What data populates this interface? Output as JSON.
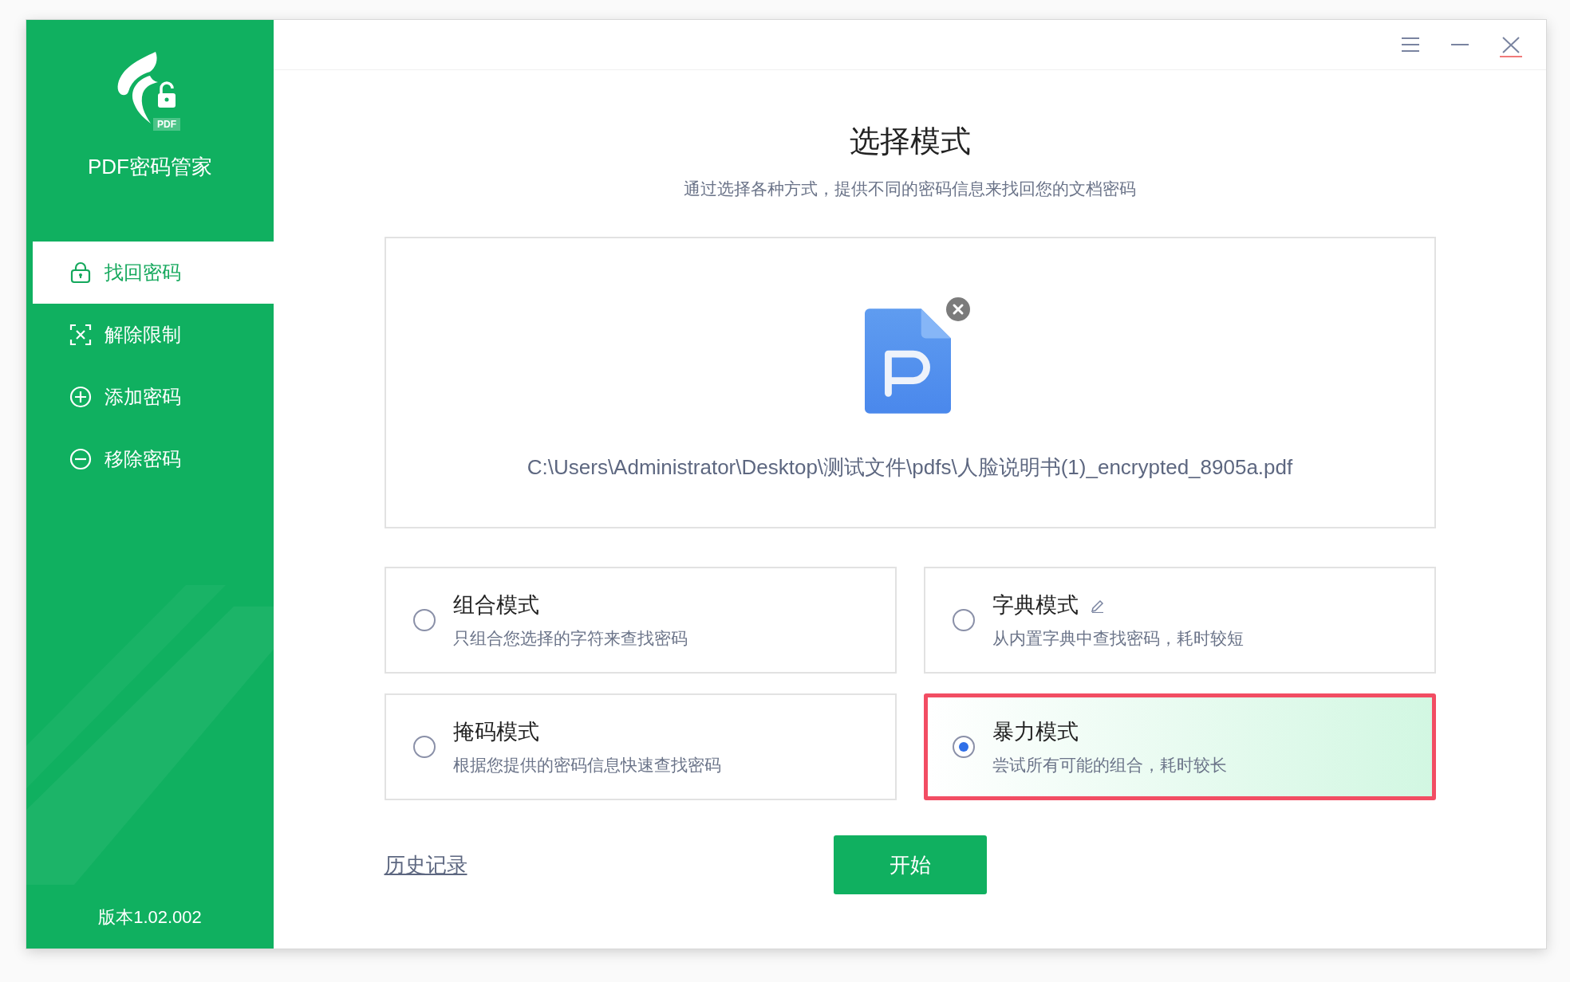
{
  "app": {
    "name": "PDF密码管家",
    "logo_badge": "PDF",
    "version": "版本1.02.002"
  },
  "sidebar": {
    "items": [
      {
        "label": "找回密码",
        "kind": "lock",
        "selected": true
      },
      {
        "label": "解除限制",
        "kind": "frame-x",
        "selected": false
      },
      {
        "label": "添加密码",
        "kind": "plus",
        "selected": false
      },
      {
        "label": "移除密码",
        "kind": "minus",
        "selected": false
      }
    ]
  },
  "page": {
    "title": "选择模式",
    "subtitle": "通过选择各种方式，提供不同的密码信息来找回您的文档密码"
  },
  "file": {
    "path": "C:\\Users\\Administrator\\Desktop\\测试文件\\pdfs\\人脸说明书(1)_encrypted_8905a.pdf"
  },
  "modes": [
    {
      "title": "组合模式",
      "description": "只组合您选择的字符来查找密码",
      "editable": false,
      "selected": false
    },
    {
      "title": "字典模式",
      "description": "从内置字典中查找密码，耗时较短",
      "editable": true,
      "selected": false
    },
    {
      "title": "掩码模式",
      "description": "根据您提供的密码信息快速查找密码",
      "editable": false,
      "selected": false
    },
    {
      "title": "暴力模式",
      "description": "尝试所有可能的组合，耗时较长",
      "editable": false,
      "selected": true
    }
  ],
  "history_link": "历史记录",
  "start_button": "开始"
}
